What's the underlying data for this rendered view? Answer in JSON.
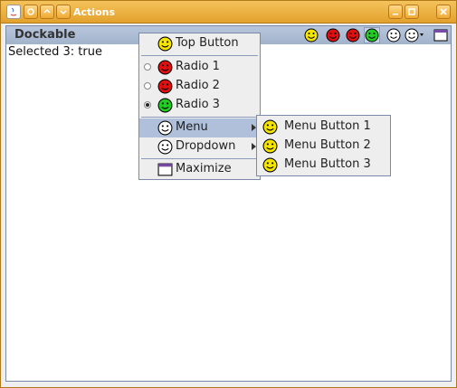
{
  "window": {
    "title": "Actions"
  },
  "dockable": {
    "title": "Dockable"
  },
  "status_text": "Selected 3: true",
  "popup": {
    "top_button": "Top Button",
    "radio_1": "Radio 1",
    "radio_2": "Radio 2",
    "radio_3": "Radio 3",
    "menu": "Menu",
    "dropdown": "Dropdown",
    "maximize": "Maximize"
  },
  "submenu": {
    "items": [
      "Menu Button 1",
      "Menu Button 2",
      "Menu Button 3"
    ]
  },
  "colors": {
    "yellow": "#f5e400",
    "red": "#e01010",
    "green": "#22cc22",
    "white": "#ffffff",
    "titlebar": "#e8aa35",
    "highlight": "#b0c0da"
  },
  "icons": [
    "java-icon",
    "pin-icon",
    "minimize-icon",
    "restore-icon",
    "smiley-yellow-icon",
    "smiley-red-icon",
    "smiley-green-icon",
    "smiley-white-icon",
    "maximize-icon",
    "close-icon"
  ]
}
